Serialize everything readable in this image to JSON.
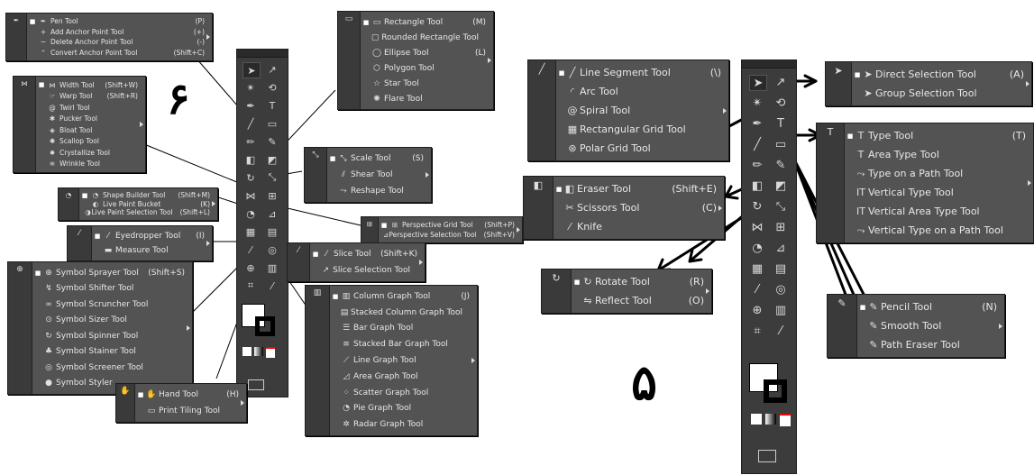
{
  "labels": {
    "left_number": "۶",
    "right_number": "۵"
  },
  "left": {
    "pen_menu": [
      {
        "icon": "pen-icon",
        "glyph": "✒",
        "label": "Pen Tool",
        "shortcut": "(P)",
        "active": true
      },
      {
        "icon": "add-anchor-icon",
        "glyph": "+",
        "label": "Add Anchor Point Tool",
        "shortcut": "(+)"
      },
      {
        "icon": "delete-anchor-icon",
        "glyph": "−",
        "label": "Delete Anchor Point Tool",
        "shortcut": "(-)"
      },
      {
        "icon": "convert-anchor-icon",
        "glyph": "⌃",
        "label": "Convert Anchor Point Tool",
        "shortcut": "(Shift+C)"
      }
    ],
    "width_menu": [
      {
        "icon": "width-icon",
        "glyph": "⋈",
        "label": "Width Tool",
        "shortcut": "(Shift+W)",
        "active": true
      },
      {
        "icon": "warp-icon",
        "glyph": "☞",
        "label": "Warp Tool",
        "shortcut": "(Shift+R)"
      },
      {
        "icon": "twirl-icon",
        "glyph": "@",
        "label": "Twirl Tool",
        "shortcut": ""
      },
      {
        "icon": "pucker-icon",
        "glyph": "✱",
        "label": "Pucker Tool",
        "shortcut": ""
      },
      {
        "icon": "bloat-icon",
        "glyph": "◈",
        "label": "Bloat Tool",
        "shortcut": ""
      },
      {
        "icon": "scallop-icon",
        "glyph": "✺",
        "label": "Scallop Tool",
        "shortcut": ""
      },
      {
        "icon": "crystallize-icon",
        "glyph": "✹",
        "label": "Crystallize Tool",
        "shortcut": ""
      },
      {
        "icon": "wrinkle-icon",
        "glyph": "≋",
        "label": "Wrinkle Tool",
        "shortcut": ""
      }
    ],
    "shape_builder_menu": [
      {
        "icon": "shape-builder-icon",
        "glyph": "◔",
        "label": "Shape Builder Tool",
        "shortcut": "(Shift+M)",
        "active": true
      },
      {
        "icon": "live-paint-bucket-icon",
        "glyph": "◐",
        "label": "Live Paint Bucket",
        "shortcut": "(K)"
      },
      {
        "icon": "live-paint-selection-icon",
        "glyph": "◑",
        "label": "Live Paint Selection Tool",
        "shortcut": "(Shift+L)"
      }
    ],
    "eyedropper_menu": [
      {
        "icon": "eyedropper-icon",
        "glyph": "⁄",
        "label": "Eyedropper Tool",
        "shortcut": "(I)",
        "active": true
      },
      {
        "icon": "measure-icon",
        "glyph": "▬",
        "label": "Measure Tool",
        "shortcut": ""
      }
    ],
    "symbol_menu": [
      {
        "icon": "symbol-sprayer-icon",
        "glyph": "⊕",
        "label": "Symbol Sprayer Tool",
        "shortcut": "(Shift+S)",
        "active": true
      },
      {
        "icon": "symbol-shifter-icon",
        "glyph": "↯",
        "label": "Symbol Shifter Tool",
        "shortcut": ""
      },
      {
        "icon": "symbol-scruncher-icon",
        "glyph": "∞",
        "label": "Symbol Scruncher Tool",
        "shortcut": ""
      },
      {
        "icon": "symbol-sizer-icon",
        "glyph": "⊙",
        "label": "Symbol Sizer Tool",
        "shortcut": ""
      },
      {
        "icon": "symbol-spinner-icon",
        "glyph": "↻",
        "label": "Symbol Spinner Tool",
        "shortcut": ""
      },
      {
        "icon": "symbol-stainer-icon",
        "glyph": "♣",
        "label": "Symbol Stainer Tool",
        "shortcut": ""
      },
      {
        "icon": "symbol-screener-icon",
        "glyph": "◎",
        "label": "Symbol Screener Tool",
        "shortcut": ""
      },
      {
        "icon": "symbol-styler-icon",
        "glyph": "●",
        "label": "Symbol Styler",
        "shortcut": ""
      }
    ],
    "hand_menu": [
      {
        "icon": "hand-icon",
        "glyph": "✋",
        "label": "Hand Tool",
        "shortcut": "(H)",
        "active": true
      },
      {
        "icon": "print-tiling-icon",
        "glyph": "▭",
        "label": "Print Tiling Tool",
        "shortcut": ""
      }
    ],
    "rect_menu": [
      {
        "icon": "rectangle-icon",
        "glyph": "▭",
        "label": "Rectangle Tool",
        "shortcut": "(M)",
        "active": true
      },
      {
        "icon": "rounded-rectangle-icon",
        "glyph": "▢",
        "label": "Rounded Rectangle Tool",
        "shortcut": ""
      },
      {
        "icon": "ellipse-icon",
        "glyph": "◯",
        "label": "Ellipse Tool",
        "shortcut": "(L)"
      },
      {
        "icon": "polygon-icon",
        "glyph": "⬡",
        "label": "Polygon Tool",
        "shortcut": ""
      },
      {
        "icon": "star-icon",
        "glyph": "☆",
        "label": "Star Tool",
        "shortcut": ""
      },
      {
        "icon": "flare-icon",
        "glyph": "✺",
        "label": "Flare Tool",
        "shortcut": ""
      }
    ],
    "scale_menu": [
      {
        "icon": "scale-icon",
        "glyph": "⤡",
        "label": "Scale Tool",
        "shortcut": "(S)",
        "active": true
      },
      {
        "icon": "shear-icon",
        "glyph": "⫽",
        "label": "Shear Tool",
        "shortcut": ""
      },
      {
        "icon": "reshape-icon",
        "glyph": "⤳",
        "label": "Reshape Tool",
        "shortcut": ""
      }
    ],
    "perspective_menu": [
      {
        "icon": "perspective-grid-icon",
        "glyph": "⊞",
        "label": "Perspective Grid Tool",
        "shortcut": "(Shift+P)",
        "active": true
      },
      {
        "icon": "perspective-selection-icon",
        "glyph": "⊿",
        "label": "Perspective Selection Tool",
        "shortcut": "(Shift+V)"
      }
    ],
    "slice_menu": [
      {
        "icon": "slice-icon",
        "glyph": "⁄",
        "label": "Slice Tool",
        "shortcut": "(Shift+K)",
        "active": true
      },
      {
        "icon": "slice-selection-icon",
        "glyph": "↗",
        "label": "Slice Selection Tool",
        "shortcut": ""
      }
    ],
    "graph_menu": [
      {
        "icon": "column-graph-icon",
        "glyph": "▥",
        "label": "Column Graph Tool",
        "shortcut": "(J)",
        "active": true
      },
      {
        "icon": "stacked-column-graph-icon",
        "glyph": "▤",
        "label": "Stacked Column Graph Tool",
        "shortcut": ""
      },
      {
        "icon": "bar-graph-icon",
        "glyph": "☰",
        "label": "Bar Graph Tool",
        "shortcut": ""
      },
      {
        "icon": "stacked-bar-graph-icon",
        "glyph": "≡",
        "label": "Stacked Bar Graph Tool",
        "shortcut": ""
      },
      {
        "icon": "line-graph-icon",
        "glyph": "⟋",
        "label": "Line Graph Tool",
        "shortcut": ""
      },
      {
        "icon": "area-graph-icon",
        "glyph": "◿",
        "label": "Area Graph Tool",
        "shortcut": ""
      },
      {
        "icon": "scatter-graph-icon",
        "glyph": "⁘",
        "label": "Scatter Graph Tool",
        "shortcut": ""
      },
      {
        "icon": "pie-graph-icon",
        "glyph": "◔",
        "label": "Pie Graph Tool",
        "shortcut": ""
      },
      {
        "icon": "radar-graph-icon",
        "glyph": "✲",
        "label": "Radar Graph Tool",
        "shortcut": ""
      }
    ]
  },
  "right": {
    "line_menu": [
      {
        "icon": "line-segment-icon",
        "glyph": "╱",
        "label": "Line Segment Tool",
        "shortcut": "(\\)",
        "active": true
      },
      {
        "icon": "arc-icon",
        "glyph": "◜",
        "label": "Arc Tool",
        "shortcut": ""
      },
      {
        "icon": "spiral-icon",
        "glyph": "@",
        "label": "Spiral Tool",
        "shortcut": ""
      },
      {
        "icon": "rectangular-grid-icon",
        "glyph": "▦",
        "label": "Rectangular Grid Tool",
        "shortcut": ""
      },
      {
        "icon": "polar-grid-icon",
        "glyph": "⊛",
        "label": "Polar Grid Tool",
        "shortcut": ""
      }
    ],
    "eraser_menu": [
      {
        "icon": "eraser-icon",
        "glyph": "◧",
        "label": "Eraser Tool",
        "shortcut": "(Shift+E)",
        "active": true
      },
      {
        "icon": "scissors-icon",
        "glyph": "✂",
        "label": "Scissors Tool",
        "shortcut": "(C)"
      },
      {
        "icon": "knife-icon",
        "glyph": "⁄",
        "label": "Knife",
        "shortcut": ""
      }
    ],
    "rotate_menu": [
      {
        "icon": "rotate-icon",
        "glyph": "↻",
        "label": "Rotate Tool",
        "shortcut": "(R)",
        "active": true
      },
      {
        "icon": "reflect-icon",
        "glyph": "⇋",
        "label": "Reflect Tool",
        "shortcut": "(O)"
      }
    ],
    "selection_menu": [
      {
        "icon": "direct-selection-icon",
        "glyph": "➤",
        "label": "Direct Selection Tool",
        "shortcut": "(A)",
        "active": true
      },
      {
        "icon": "group-selection-icon",
        "glyph": "➤",
        "label": "Group Selection Tool",
        "shortcut": ""
      }
    ],
    "type_menu": [
      {
        "icon": "type-icon",
        "glyph": "T",
        "label": "Type Tool",
        "shortcut": "(T)",
        "active": true
      },
      {
        "icon": "area-type-icon",
        "glyph": "T",
        "label": "Area Type Tool",
        "shortcut": ""
      },
      {
        "icon": "type-on-path-icon",
        "glyph": "⤳",
        "label": "Type on a Path Tool",
        "shortcut": ""
      },
      {
        "icon": "vertical-type-icon",
        "glyph": "IT",
        "label": "Vertical Type Tool",
        "shortcut": ""
      },
      {
        "icon": "vertical-area-type-icon",
        "glyph": "IT",
        "label": "Vertical Area Type Tool",
        "shortcut": ""
      },
      {
        "icon": "vertical-type-on-path-icon",
        "glyph": "⤳",
        "label": "Vertical Type on a Path Tool",
        "shortcut": ""
      }
    ],
    "pencil_menu": [
      {
        "icon": "pencil-icon",
        "glyph": "✎",
        "label": "Pencil Tool",
        "shortcut": "(N)",
        "active": true
      },
      {
        "icon": "smooth-icon",
        "glyph": "✎",
        "label": "Smooth Tool",
        "shortcut": ""
      },
      {
        "icon": "path-eraser-icon",
        "glyph": "✎",
        "label": "Path Eraser Tool",
        "shortcut": ""
      }
    ]
  },
  "toolbar_glyphs": [
    "➤",
    "↗",
    "✴",
    "⟲",
    "✒",
    "T",
    "╱",
    "▭",
    "✏",
    "✎",
    "◧",
    "◩",
    "↻",
    "⤡",
    "⋈",
    "⊞",
    "◔",
    "⊿",
    "▦",
    "▤",
    "⁄",
    "◎",
    "⊕",
    "▥",
    "⌗",
    "⁄",
    "✋",
    "🔍"
  ]
}
